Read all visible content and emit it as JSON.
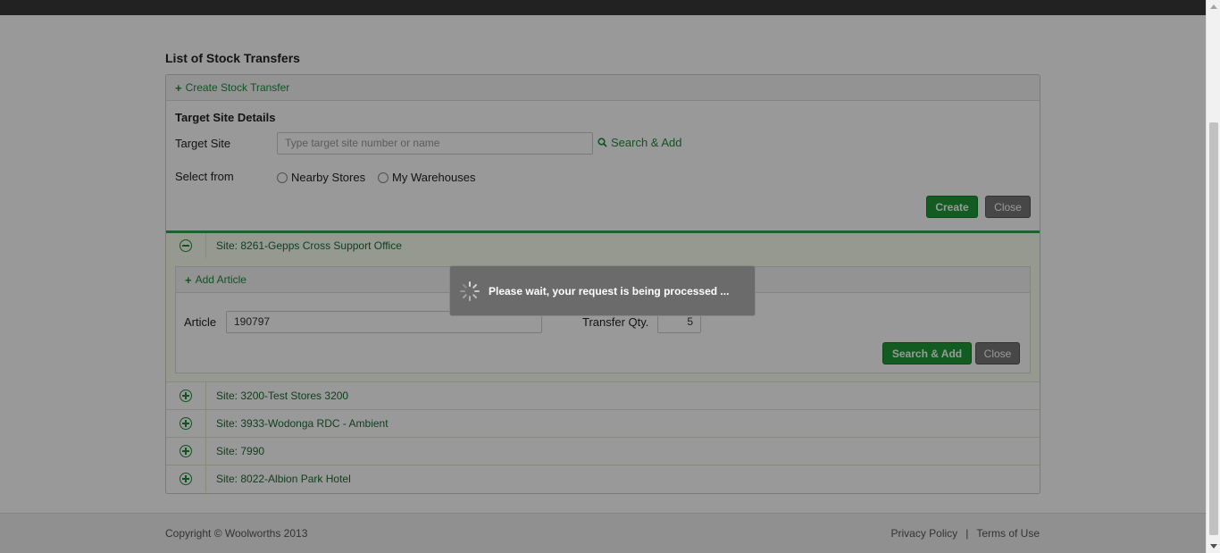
{
  "page": {
    "title": "List of Stock Transfers"
  },
  "create_panel": {
    "header_link": "Create Stock Transfer",
    "section_title": "Target Site Details",
    "target_site_label": "Target Site",
    "target_site_placeholder": "Type target site number or name",
    "search_add_link": "Search & Add",
    "select_from_label": "Select from",
    "radio_nearby": "Nearby Stores",
    "radio_warehouses": "My Warehouses",
    "create_button": "Create",
    "close_button": "Close"
  },
  "sites": [
    {
      "label": "Site: 8261-Gepps Cross Support Office",
      "expanded": true
    },
    {
      "label": "Site: 3200-Test Stores 3200",
      "expanded": false
    },
    {
      "label": "Site: 3933-Wodonga RDC - Ambient",
      "expanded": false
    },
    {
      "label": "Site: 7990",
      "expanded": false
    },
    {
      "label": "Site: 8022-Albion Park Hotel",
      "expanded": false
    }
  ],
  "add_article": {
    "header_link": "Add Article",
    "article_label": "Article",
    "article_value": "190797",
    "qty_label": "Transfer Qty.",
    "qty_value": "5",
    "search_add_button": "Search & Add",
    "close_button": "Close"
  },
  "loading": {
    "message": "Please wait, your request is being processed ..."
  },
  "footer": {
    "copyright": "Copyright © Woolworths 2013",
    "privacy": "Privacy Policy",
    "separator": "|",
    "terms": "Terms of Use"
  },
  "colors": {
    "accent_green": "#1d8a3a",
    "button_green": "#1e9a3a",
    "button_grey": "#777777"
  }
}
